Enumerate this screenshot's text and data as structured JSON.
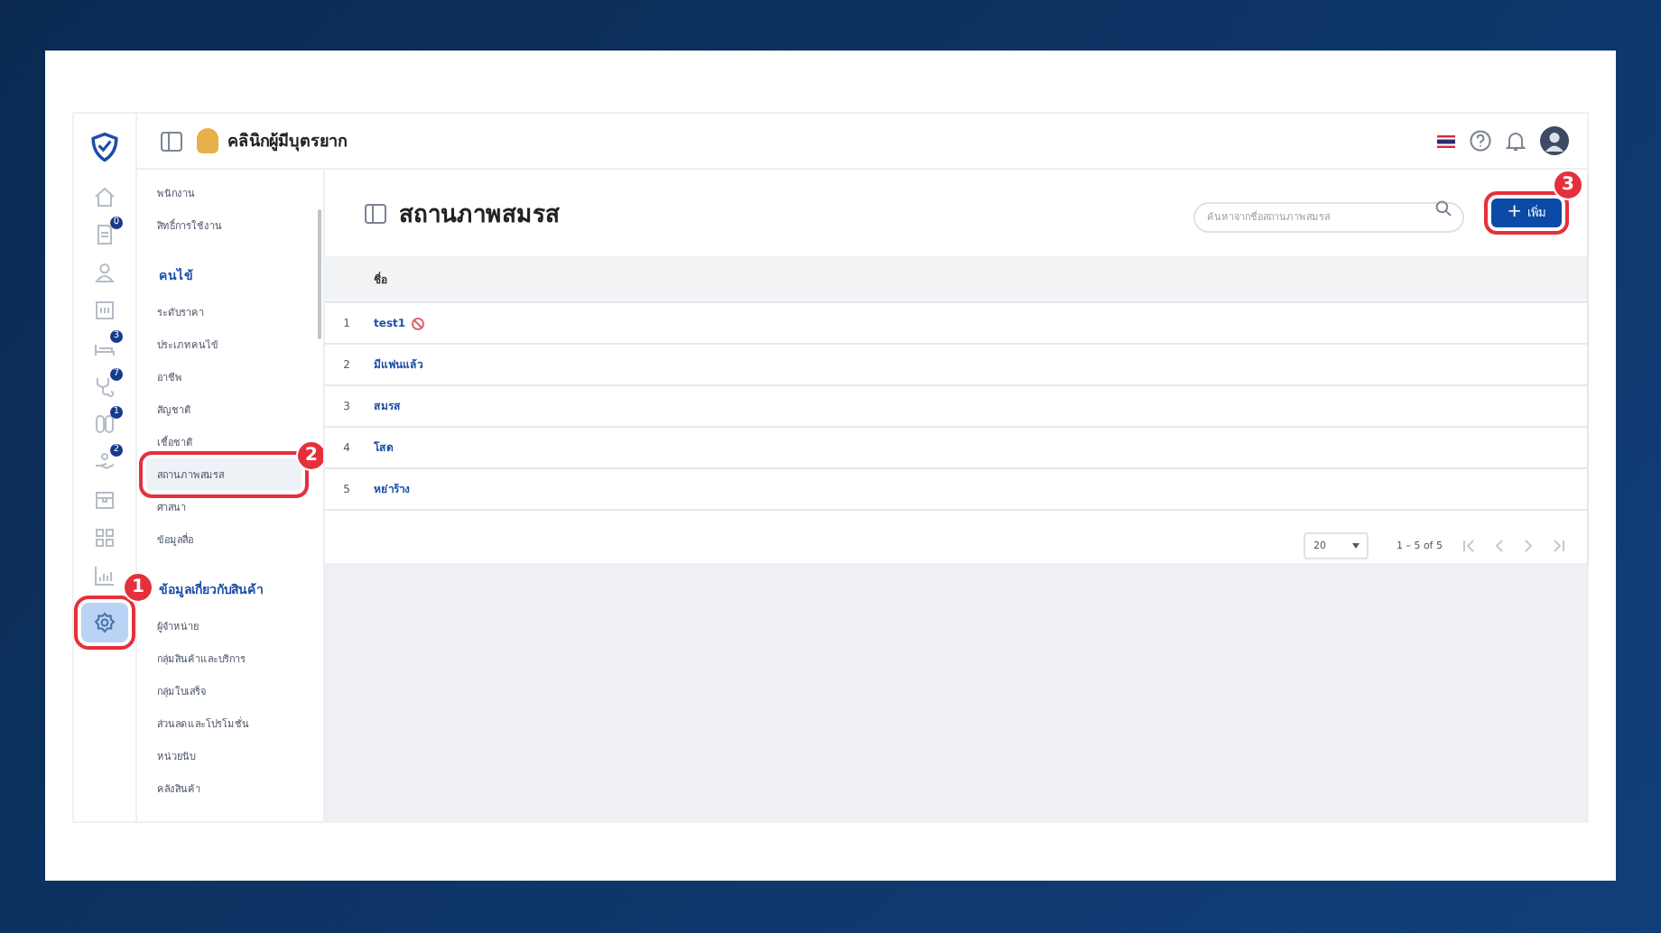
{
  "app": {
    "clinic_name": "คลินิกผู้มีบุตรยาก"
  },
  "rail": [
    {
      "kind": "home",
      "selected": false
    },
    {
      "kind": "document",
      "badge": "0",
      "selected": false
    },
    {
      "kind": "person",
      "selected": false
    },
    {
      "kind": "card",
      "selected": false
    },
    {
      "kind": "bed",
      "badge": "3",
      "selected": false
    },
    {
      "kind": "stethoscope",
      "badge": "7",
      "selected": false
    },
    {
      "kind": "pill",
      "badge": "1",
      "selected": false
    },
    {
      "kind": "hand",
      "badge": "2",
      "selected": false
    },
    {
      "kind": "box",
      "selected": false
    },
    {
      "kind": "grid",
      "selected": false
    },
    {
      "kind": "chart",
      "selected": false
    },
    {
      "kind": "settings",
      "selected": true,
      "callout": "1"
    }
  ],
  "sidebar": {
    "sections": [
      {
        "items": [
          {
            "label": "พนักงาน",
            "selected": false
          },
          {
            "label": "สิทธิ์การใช้งาน",
            "selected": false
          }
        ]
      },
      {
        "title": "คนไข้",
        "items": [
          {
            "label": "ระดับราคา",
            "selected": false
          },
          {
            "label": "ประเภทคนไข้",
            "selected": false
          },
          {
            "label": "อาชีพ",
            "selected": false
          },
          {
            "label": "สัญชาติ",
            "selected": false
          },
          {
            "label": "เชื้อชาติ",
            "selected": false
          },
          {
            "label": "สถานภาพสมรส",
            "selected": true,
            "callout": "2"
          },
          {
            "label": "ศาสนา",
            "selected": false
          },
          {
            "label": "ข้อมูลสื่อ",
            "selected": false
          }
        ]
      },
      {
        "title": "ข้อมูลเกี่ยวกับสินค้า",
        "items": [
          {
            "label": "ผู้จำหน่าย",
            "selected": false
          },
          {
            "label": "กลุ่มสินค้าและบริการ",
            "selected": false
          },
          {
            "label": "กลุ่มใบเสร็จ",
            "selected": false
          },
          {
            "label": "ส่วนลดและโปรโมชั่น",
            "selected": false
          },
          {
            "label": "หน่วยนับ",
            "selected": false
          },
          {
            "label": "คลังสินค้า",
            "selected": false
          }
        ]
      }
    ]
  },
  "page": {
    "title": "สถานภาพสมรส",
    "search": {
      "placeholder": "ค้นหาจากชื่อสถานภาพสมรส"
    },
    "add_button": {
      "label": "เพิ่ม",
      "icon": "+",
      "callout": "3"
    }
  },
  "table": {
    "columns": [
      "ชื่อ"
    ],
    "rows": [
      {
        "index": "1",
        "name": "test1",
        "disabled": true
      },
      {
        "index": "2",
        "name": "มีแฟนแล้ว",
        "disabled": false
      },
      {
        "index": "3",
        "name": "สมรส",
        "disabled": false
      },
      {
        "index": "4",
        "name": "โสด",
        "disabled": false
      },
      {
        "index": "5",
        "name": "หย่าร้าง",
        "disabled": false
      }
    ]
  },
  "pagination": {
    "page_size": "20",
    "range": "1 – 5 of 5"
  }
}
